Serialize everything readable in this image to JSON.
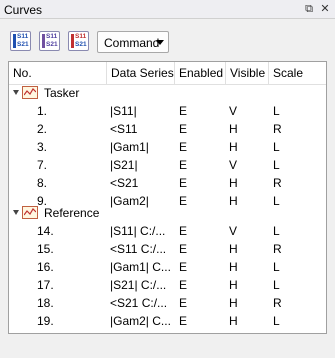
{
  "window": {
    "title": "Curves",
    "restore_glyph": "⧉",
    "close_glyph": "✕"
  },
  "toolbar": {
    "icons": [
      {
        "name": "s11-s21-icon",
        "top": "S11",
        "bottom": "S21"
      },
      {
        "name": "s11-s21-overlay-icon",
        "top": "S11",
        "bottom": "S21"
      },
      {
        "name": "s11-s21-dual-icon",
        "top": "S11",
        "bottom": "S21"
      }
    ],
    "command_label": "Command"
  },
  "table": {
    "columns": [
      "No.",
      "Data Series",
      "Enabled",
      "Visible",
      "Scale"
    ],
    "groups": [
      {
        "label": "Tasker",
        "rows": [
          {
            "no": "1.",
            "series": "|S11|",
            "enabled": "E",
            "visible": "V",
            "scale": "L"
          },
          {
            "no": "2.",
            "series": "<S11",
            "enabled": "E",
            "visible": "H",
            "scale": "R"
          },
          {
            "no": "3.",
            "series": "|Gam1|",
            "enabled": "E",
            "visible": "H",
            "scale": "L"
          },
          {
            "no": "7.",
            "series": "|S21|",
            "enabled": "E",
            "visible": "V",
            "scale": "L"
          },
          {
            "no": "8.",
            "series": "<S21",
            "enabled": "E",
            "visible": "H",
            "scale": "R"
          },
          {
            "no": "9.",
            "series": "|Gam2|",
            "enabled": "E",
            "visible": "H",
            "scale": "L"
          }
        ]
      },
      {
        "label": "Reference",
        "rows": [
          {
            "no": "14.",
            "series": "|S11|  C:/...",
            "enabled": "E",
            "visible": "V",
            "scale": "L"
          },
          {
            "no": "15.",
            "series": "<S11  C:/...",
            "enabled": "E",
            "visible": "H",
            "scale": "R"
          },
          {
            "no": "16.",
            "series": "|Gam1|  C...",
            "enabled": "E",
            "visible": "H",
            "scale": "L"
          },
          {
            "no": "17.",
            "series": "|S21|  C:/...",
            "enabled": "E",
            "visible": "H",
            "scale": "L"
          },
          {
            "no": "18.",
            "series": "<S21  C:/...",
            "enabled": "E",
            "visible": "H",
            "scale": "R"
          },
          {
            "no": "19.",
            "series": "|Gam2|  C...",
            "enabled": "E",
            "visible": "H",
            "scale": "L"
          }
        ]
      }
    ]
  },
  "colors": {
    "accent": "#3060c0",
    "icon_red": "#c03030",
    "icon_blue": "#2050b0"
  }
}
